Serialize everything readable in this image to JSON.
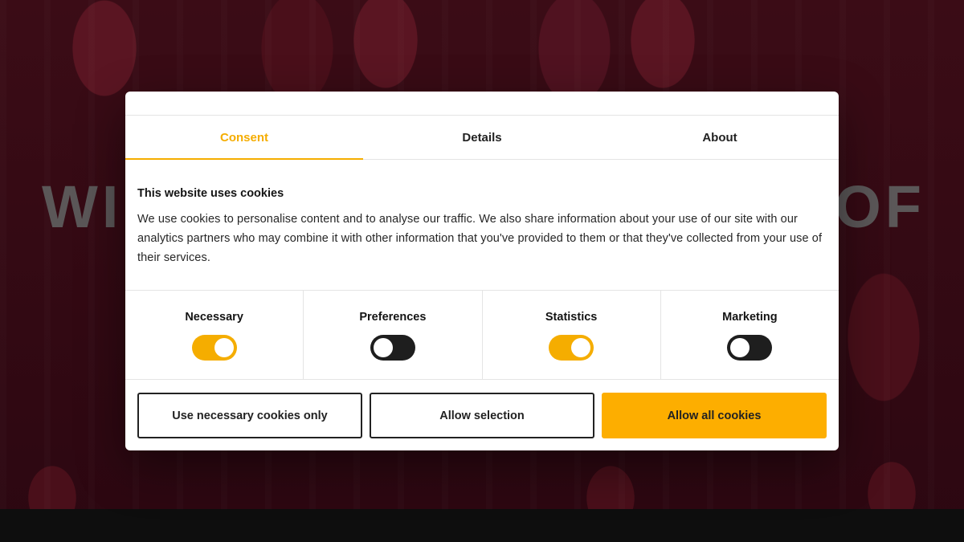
{
  "background": {
    "headline_left": "WI",
    "headline_right": "OF"
  },
  "tabs": [
    {
      "label": "Consent",
      "active": true
    },
    {
      "label": "Details",
      "active": false
    },
    {
      "label": "About",
      "active": false
    }
  ],
  "consent": {
    "title": "This website uses cookies",
    "text": "We use cookies to personalise content and to analyse our traffic. We also share information about your use of our site with our analytics partners who may combine it with other information that you've provided to them or that they've collected from your use of their services."
  },
  "toggles": [
    {
      "label": "Necessary",
      "on": true
    },
    {
      "label": "Preferences",
      "on": false
    },
    {
      "label": "Statistics",
      "on": true
    },
    {
      "label": "Marketing",
      "on": false
    }
  ],
  "buttons": {
    "necessary_only": "Use necessary cookies only",
    "allow_selection": "Allow selection",
    "allow_all": "Allow all cookies"
  },
  "colors": {
    "accent": "#f5ad00",
    "toggle_off": "#1e1e1e",
    "background": "#2a0810"
  }
}
